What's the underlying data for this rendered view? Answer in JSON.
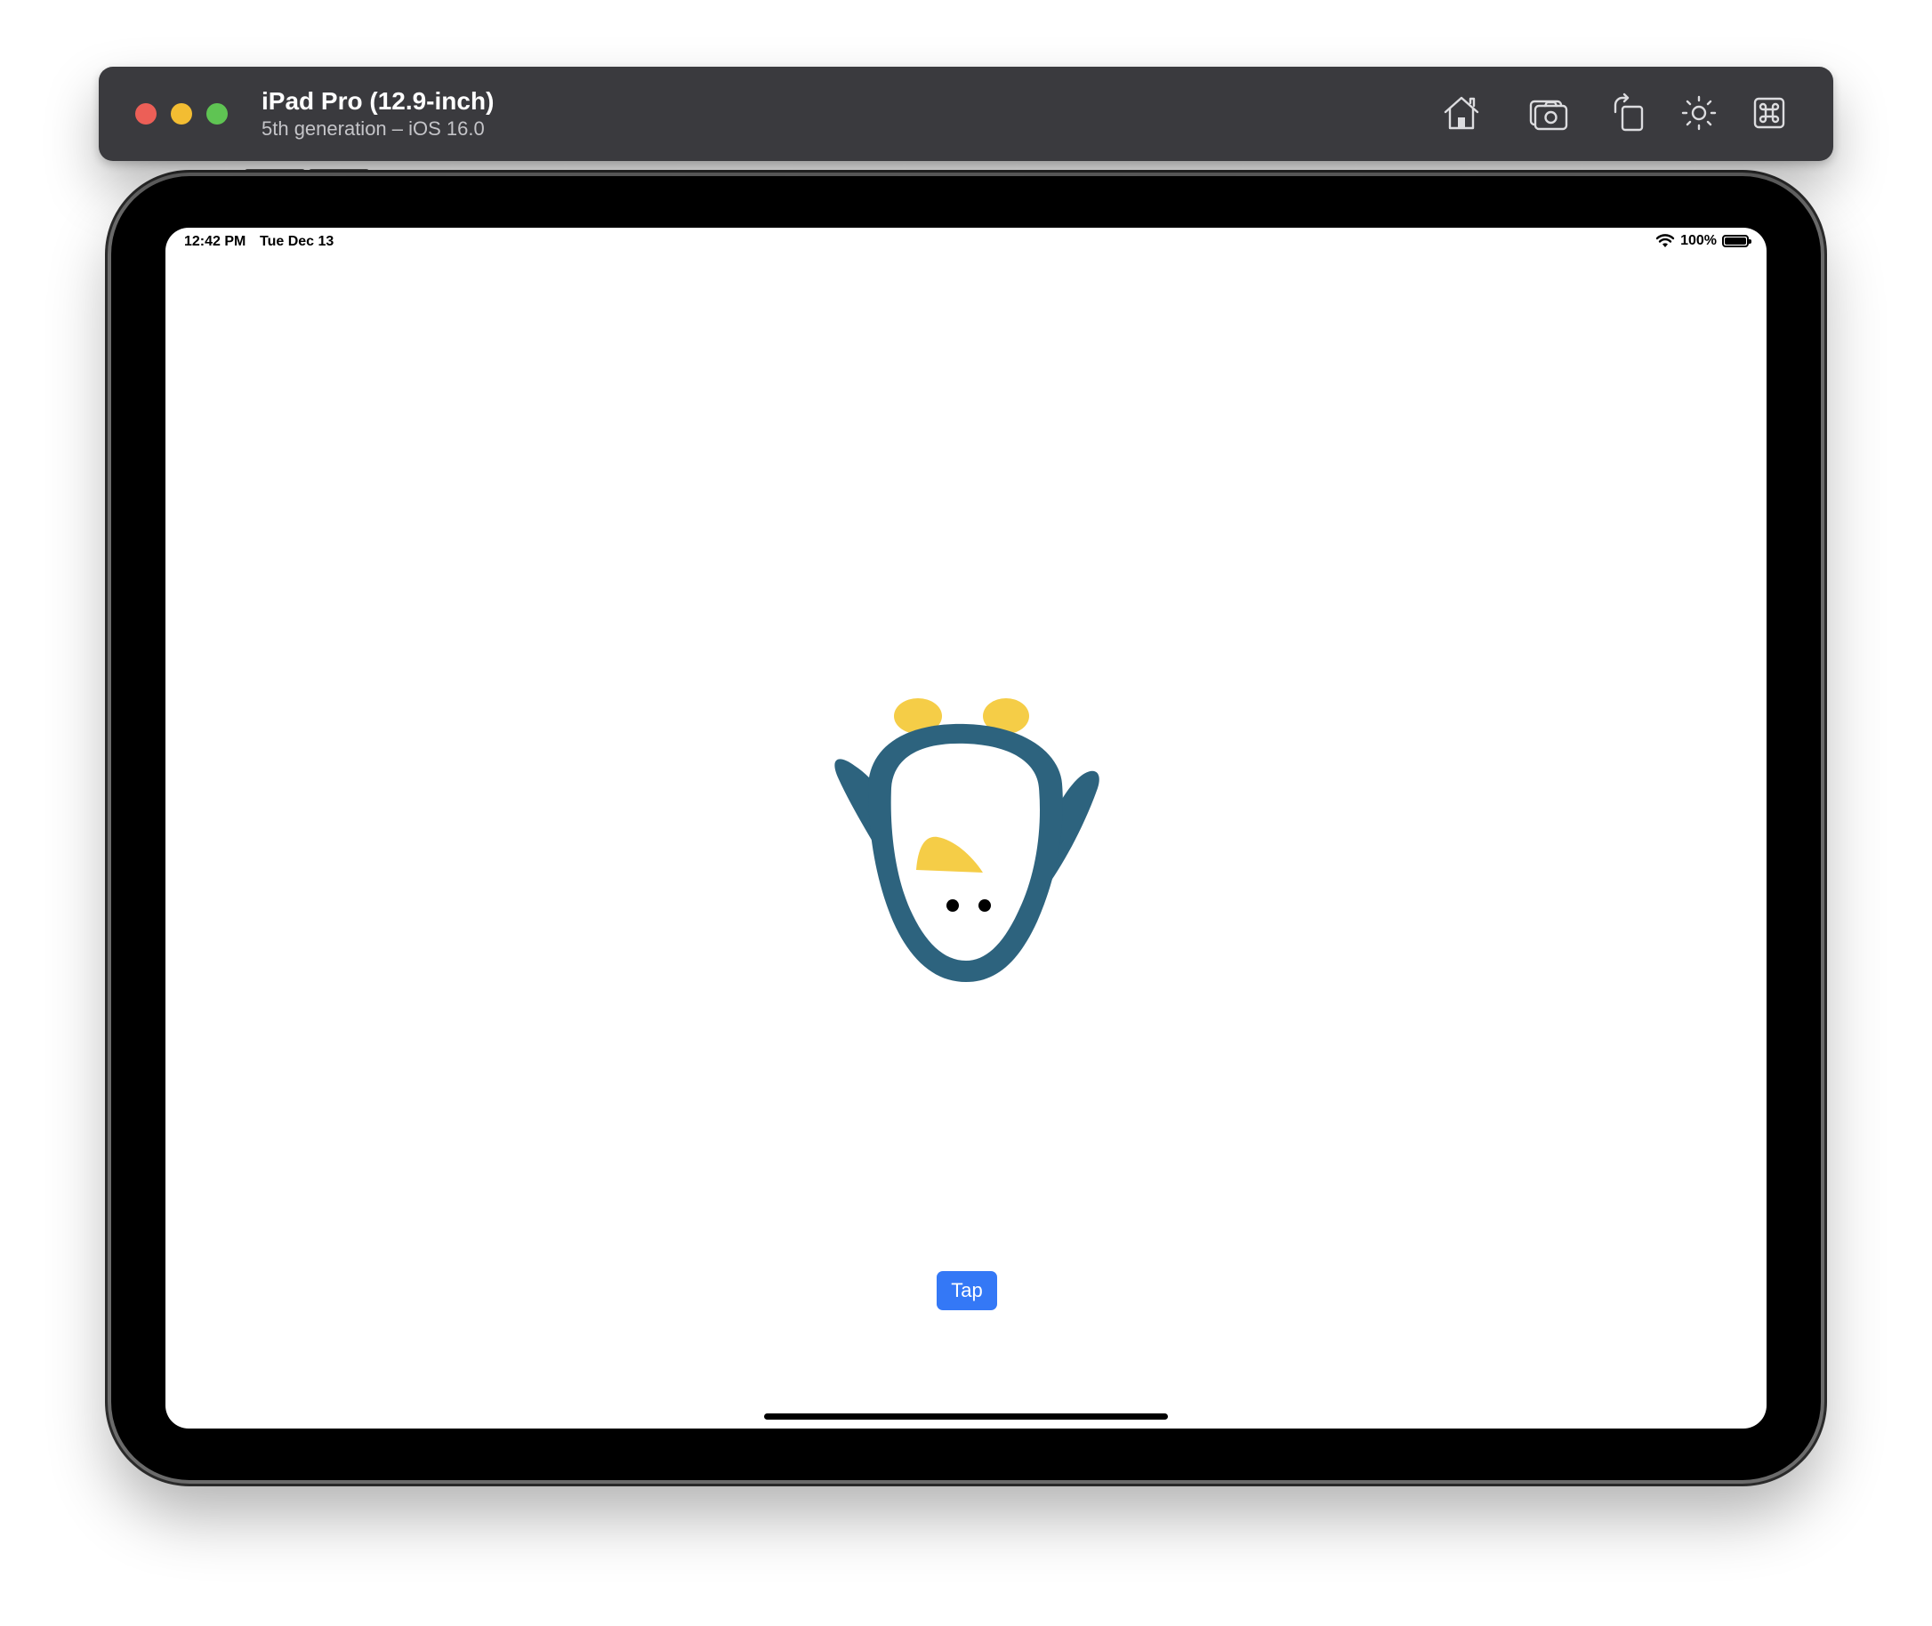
{
  "window": {
    "device_name": "iPad Pro (12.9-inch)",
    "device_subtitle": "5th generation – iOS 16.0"
  },
  "toolbar": {
    "icons": [
      "home-icon",
      "screenshot-icon",
      "rotate-icon",
      "appearance-icon",
      "command-icon"
    ]
  },
  "status_bar": {
    "time": "12:42 PM",
    "date": "Tue Dec 13",
    "battery": "100%"
  },
  "app": {
    "tap_label": "Tap"
  },
  "colors": {
    "penguin_body": "#2d637e",
    "penguin_accent": "#f5cd47",
    "button": "#3478f6",
    "titlebar": "#3a3a3e"
  }
}
